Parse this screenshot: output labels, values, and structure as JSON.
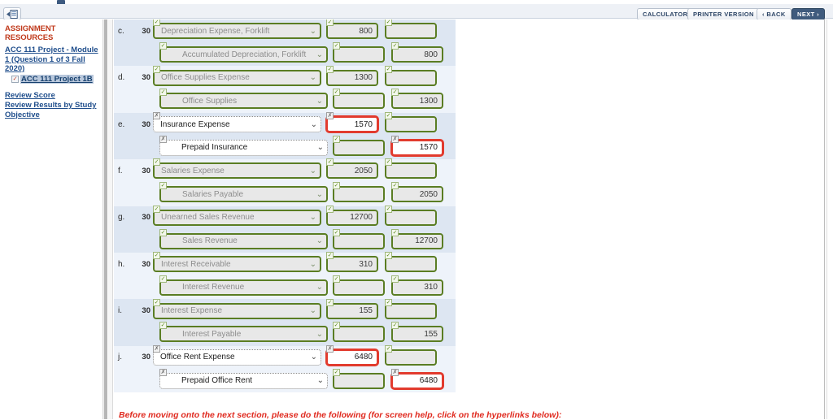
{
  "topbar": {
    "panel_toggle_name": "toggle-navigation-panel",
    "buttons": [
      {
        "label": "CALCULATOR",
        "name": "calculator-button"
      },
      {
        "label": "PRINTER VERSION",
        "name": "printer-version-button"
      },
      {
        "label": "‹ BACK",
        "name": "back-button"
      },
      {
        "label": "NEXT ›",
        "name": "next-button"
      }
    ]
  },
  "sidebar": {
    "heading": "ASSIGNMENT RESOURCES",
    "assignment_link": "ACC 111 Project - Module 1 (Question 1 of 3 Fall 2020)",
    "selected_item": "ACC 111 Project 1B",
    "selected_item_checkmark": "✓",
    "links": [
      "Review Score",
      "Review Results by Study Objective"
    ]
  },
  "journal": {
    "dropdown_caret": "⌄",
    "status_ok": "✓",
    "status_bad": "✗",
    "rows": [
      {
        "letter": "c.",
        "debit": {
          "day": "30",
          "account": "Depreciation Expense, Forklift",
          "account_status": "ok",
          "debit_amount": "800",
          "debit_status": "ok",
          "credit_amount": "",
          "credit_status": "ok"
        },
        "credit": {
          "day": "",
          "account": "Accumulated Depreciation, Forklift",
          "account_status": "ok",
          "debit_amount": "",
          "debit_status": "ok",
          "credit_amount": "800",
          "credit_status": "ok"
        }
      },
      {
        "letter": "d.",
        "debit": {
          "day": "30",
          "account": "Office Supplies Expense",
          "account_status": "ok",
          "debit_amount": "1300",
          "debit_status": "ok",
          "credit_amount": "",
          "credit_status": "ok"
        },
        "credit": {
          "day": "",
          "account": "Office Supplies",
          "account_status": "ok",
          "debit_amount": "",
          "debit_status": "ok",
          "credit_amount": "1300",
          "credit_status": "ok"
        }
      },
      {
        "letter": "e.",
        "debit": {
          "day": "30",
          "account": "Insurance Expense",
          "account_status": "bad",
          "debit_amount": "1570",
          "debit_status": "bad",
          "credit_amount": "",
          "credit_status": "ok"
        },
        "credit": {
          "day": "",
          "account": "Prepaid Insurance",
          "account_status": "bad",
          "debit_amount": "",
          "debit_status": "ok",
          "credit_amount": "1570",
          "credit_status": "bad"
        }
      },
      {
        "letter": "f.",
        "debit": {
          "day": "30",
          "account": "Salaries Expense",
          "account_status": "ok",
          "debit_amount": "2050",
          "debit_status": "ok",
          "credit_amount": "",
          "credit_status": "ok"
        },
        "credit": {
          "day": "",
          "account": "Salaries Payable",
          "account_status": "ok",
          "debit_amount": "",
          "debit_status": "ok",
          "credit_amount": "2050",
          "credit_status": "ok"
        }
      },
      {
        "letter": "g.",
        "debit": {
          "day": "30",
          "account": "Unearned Sales Revenue",
          "account_status": "ok",
          "debit_amount": "12700",
          "debit_status": "ok",
          "credit_amount": "",
          "credit_status": "ok"
        },
        "credit": {
          "day": "",
          "account": "Sales Revenue",
          "account_status": "ok",
          "debit_amount": "",
          "debit_status": "ok",
          "credit_amount": "12700",
          "credit_status": "ok"
        }
      },
      {
        "letter": "h.",
        "debit": {
          "day": "30",
          "account": "Interest Receivable",
          "account_status": "ok",
          "debit_amount": "310",
          "debit_status": "ok",
          "credit_amount": "",
          "credit_status": "ok"
        },
        "credit": {
          "day": "",
          "account": "Interest Revenue",
          "account_status": "ok",
          "debit_amount": "",
          "debit_status": "ok",
          "credit_amount": "310",
          "credit_status": "ok"
        }
      },
      {
        "letter": "i.",
        "debit": {
          "day": "30",
          "account": "Interest Expense",
          "account_status": "ok",
          "debit_amount": "155",
          "debit_status": "ok",
          "credit_amount": "",
          "credit_status": "ok"
        },
        "credit": {
          "day": "",
          "account": "Interest Payable",
          "account_status": "ok",
          "debit_amount": "",
          "debit_status": "ok",
          "credit_amount": "155",
          "credit_status": "ok"
        }
      },
      {
        "letter": "j.",
        "debit": {
          "day": "30",
          "account": "Office Rent Expense",
          "account_status": "bad",
          "debit_amount": "6480",
          "debit_status": "bad",
          "credit_amount": "",
          "credit_status": "ok"
        },
        "credit": {
          "day": "",
          "account": "Prepaid Office Rent",
          "account_status": "bad",
          "debit_amount": "",
          "debit_status": "ok",
          "credit_amount": "6480",
          "credit_status": "bad"
        }
      }
    ]
  },
  "bottom_note": "Before moving onto the next section, please do the following (for screen help, click on the hyperlinks below):",
  "colors": {
    "accent_red": "#c0391b",
    "link_blue": "#1f4e8c",
    "correct_green": "#5a7d23",
    "error_red": "#e23b2e",
    "row_odd": "#dde6f2",
    "row_even": "#eef3fa",
    "next_button": "#3f5b7d"
  }
}
